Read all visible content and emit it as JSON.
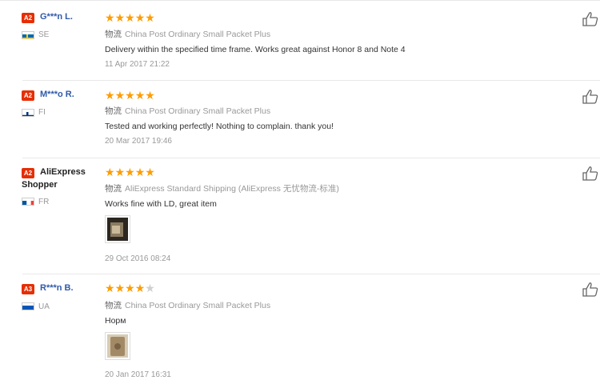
{
  "reviews": [
    {
      "level": "A2",
      "name": "G***n L.",
      "country": "SE",
      "stars": 5,
      "logistics_label": "物流",
      "logistics": "China Post Ordinary Small Packet Plus",
      "feedback": "Delivery within the specified time frame. Works great against Honor 8 and Note 4",
      "date": "11 Apr 2017 21:22"
    },
    {
      "level": "A2",
      "name": "M***o R.",
      "country": "FI",
      "stars": 5,
      "logistics_label": "物流",
      "logistics": "China Post Ordinary Small Packet Plus",
      "feedback": "Tested and working perfectly! Nothing to complain. thank you!",
      "date": "20 Mar 2017 19:46"
    },
    {
      "level": "A2",
      "name_line1": "AliExpress",
      "name_line2": "Shopper",
      "country": "FR",
      "stars": 5,
      "logistics_label": "物流",
      "logistics": "AliExpress Standard Shipping (AliExpress 无忧物流-标准)",
      "feedback": "Works fine with LD, great item",
      "date": "29 Oct 2016 08:24"
    },
    {
      "level": "A3",
      "name": "R***n B.",
      "country": "UA",
      "stars": 4,
      "logistics_label": "物流",
      "logistics": "China Post Ordinary Small Packet Plus",
      "feedback": "Норм",
      "date": "20 Jan 2017 16:31"
    }
  ],
  "icons": {
    "star": "★",
    "thumbs_up": "thumbs-up-icon",
    "flag_colors": {
      "SE": [
        "#006aa7",
        "#fecc00"
      ],
      "FI": [
        "#ffffff",
        "#003580"
      ],
      "FR": [
        "#0055a4",
        "#ffffff",
        "#ef4135"
      ],
      "UA": [
        "#0057b7",
        "#ffd700"
      ]
    },
    "star_color": "#ff9c00",
    "badge_color": "#e62e04",
    "name_color": "#2f5aa9"
  }
}
